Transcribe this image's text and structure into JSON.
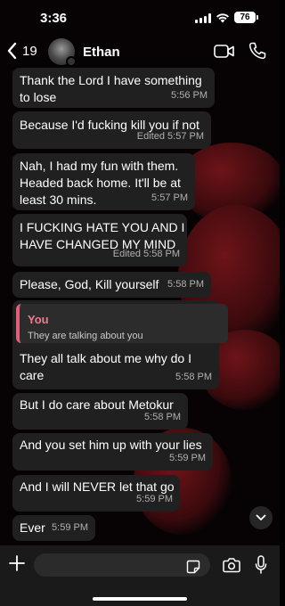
{
  "status_bar": {
    "time": "3:36",
    "battery": "76"
  },
  "header": {
    "back_count": "19",
    "contact_name": "Ethan"
  },
  "messages": [
    {
      "text": "Thank the Lord I have something\nto lose",
      "time": "5:56 PM"
    },
    {
      "text": "Because I'd fucking kill you if not",
      "time": "Edited 5:57 PM"
    },
    {
      "text": "Nah, I had my fun with them.\nHeaded back home. It'll be at\nleast 30 mins.",
      "time": "5:57 PM"
    },
    {
      "text": "I FUCKING HATE YOU AND I\nHAVE CHANGED MY MIND",
      "time": "Edited 5:58 PM"
    },
    {
      "text": "Please, God, Kill yourself",
      "time": "5:58 PM"
    },
    {
      "quote_author": "You",
      "quote_text": "They are talking about you",
      "text": "They all talk about me why do I\ncare",
      "time": "5:58 PM"
    },
    {
      "text": "But I do care about Metokur",
      "time": "5:58 PM"
    },
    {
      "text": "And you set him up with your lies",
      "time": "5:59 PM"
    },
    {
      "text": "And I will NEVER let that go",
      "time": "5:59 PM"
    },
    {
      "text": "Ever",
      "time": "5:59 PM"
    }
  ],
  "composer": {
    "placeholder": ""
  },
  "colors": {
    "bubble": "#202020",
    "quote_accent": "#e0607a",
    "background": "#070304"
  }
}
